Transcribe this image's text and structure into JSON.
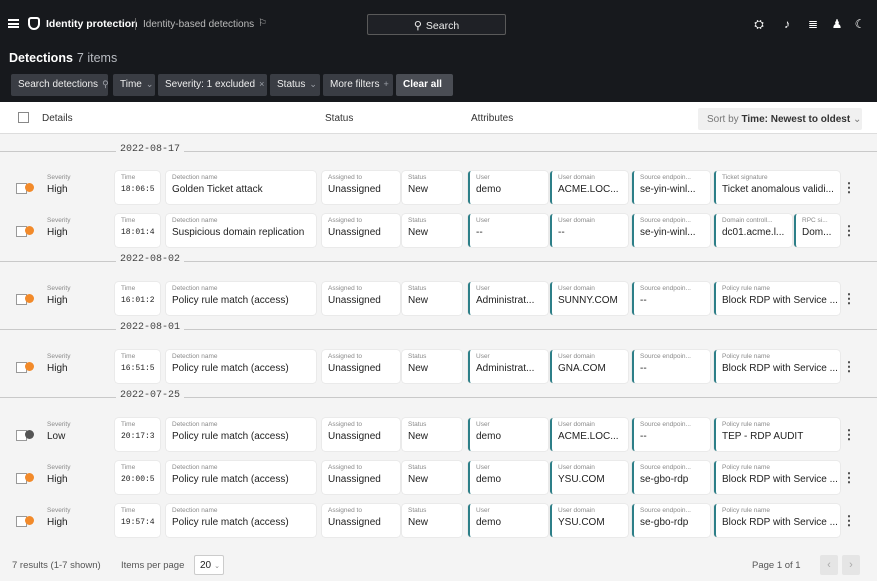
{
  "nav": {
    "app_title": "Identity protection",
    "breadcrumb": "Identity-based detections",
    "search_label": "Search"
  },
  "page": {
    "title": "Detections",
    "count": "7 items"
  },
  "filters": {
    "search": "Search detections",
    "time": "Time",
    "severity": "Severity: 1 excluded",
    "status": "Status",
    "more": "More filters",
    "clear": "Clear all"
  },
  "columns": {
    "details": "Details",
    "status": "Status",
    "attributes": "Attributes",
    "sort_prefix": "Sort by",
    "sort_value": "Time: Newest to oldest"
  },
  "labels": {
    "severity": "Severity",
    "time": "Time",
    "detection_name": "Detection name",
    "assigned_to": "Assigned to",
    "status": "Status",
    "user": "User",
    "user_domain": "User domain",
    "source_endpoint": "Source endpoin...",
    "ticket_signature": "Ticket signature",
    "domain_controller": "Domain controll...",
    "rpc": "RPC si...",
    "policy_rule_name": "Policy rule name"
  },
  "dates": [
    "2022-08-17",
    "2022-08-02",
    "2022-08-01",
    "2022-07-25"
  ],
  "colors": {
    "high": "#f28a2a",
    "low": "#555555",
    "accent": "#2d7f88",
    "header_bg": "#17191d"
  },
  "rows": [
    {
      "severity": "High",
      "time": "18:06:5",
      "name": "Golden Ticket attack",
      "assigned": "Unassigned",
      "status": "New",
      "user": "demo",
      "domain": "ACME.LOC...",
      "source": "se-yin-winl...",
      "extra_label": "Ticket signature",
      "extra_value": "Ticket anomalous validi...",
      "extra2_label": "",
      "extra2_value": ""
    },
    {
      "severity": "High",
      "time": "18:01:4",
      "name": "Suspicious domain replication",
      "assigned": "Unassigned",
      "status": "New",
      "user": "--",
      "domain": "--",
      "source": "se-yin-winl...",
      "extra_label": "Domain controll...",
      "extra_value": "dc01.acme.l...",
      "extra2_label": "RPC si...",
      "extra2_value": "Dom..."
    },
    {
      "severity": "High",
      "time": "16:01:2",
      "name": "Policy rule match (access)",
      "assigned": "Unassigned",
      "status": "New",
      "user": "Administrat...",
      "domain": "SUNNY.COM",
      "source": "--",
      "extra_label": "Policy rule name",
      "extra_value": "Block RDP with Service ...",
      "extra2_label": "",
      "extra2_value": ""
    },
    {
      "severity": "High",
      "time": "16:51:5",
      "name": "Policy rule match (access)",
      "assigned": "Unassigned",
      "status": "New",
      "user": "Administrat...",
      "domain": "GNA.COM",
      "source": "--",
      "extra_label": "Policy rule name",
      "extra_value": "Block RDP with Service ...",
      "extra2_label": "",
      "extra2_value": ""
    },
    {
      "severity": "Low",
      "time": "20:17:3",
      "name": "Policy rule match (access)",
      "assigned": "Unassigned",
      "status": "New",
      "user": "demo",
      "domain": "ACME.LOC...",
      "source": "--",
      "extra_label": "Policy rule name",
      "extra_value": "TEP - RDP AUDIT",
      "extra2_label": "",
      "extra2_value": ""
    },
    {
      "severity": "High",
      "time": "20:00:5",
      "name": "Policy rule match (access)",
      "assigned": "Unassigned",
      "status": "New",
      "user": "demo",
      "domain": "YSU.COM",
      "source": "se-gbo-rdp",
      "extra_label": "Policy rule name",
      "extra_value": "Block RDP with Service ...",
      "extra2_label": "",
      "extra2_value": ""
    },
    {
      "severity": "High",
      "time": "19:57:4",
      "name": "Policy rule match (access)",
      "assigned": "Unassigned",
      "status": "New",
      "user": "demo",
      "domain": "YSU.COM",
      "source": "se-gbo-rdp",
      "extra_label": "Policy rule name",
      "extra_value": "Block RDP with Service ...",
      "extra2_label": "",
      "extra2_value": ""
    }
  ],
  "footer": {
    "results": "7 results (1-7 shown)",
    "per_page_label": "Items per page",
    "per_page": "20",
    "page": "Page 1 of 1"
  }
}
